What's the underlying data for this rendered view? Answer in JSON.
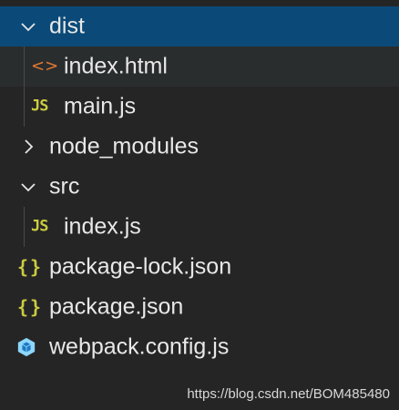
{
  "explorer": {
    "items": [
      {
        "label": "dist",
        "kind": "folder",
        "expanded": true,
        "depth": 0,
        "selected": true
      },
      {
        "label": "index.html",
        "kind": "html",
        "depth": 1,
        "hover": true
      },
      {
        "label": "main.js",
        "kind": "js",
        "depth": 1
      },
      {
        "label": "node_modules",
        "kind": "folder",
        "expanded": false,
        "depth": 0
      },
      {
        "label": "src",
        "kind": "folder",
        "expanded": true,
        "depth": 0
      },
      {
        "label": "index.js",
        "kind": "js",
        "depth": 1
      },
      {
        "label": "package-lock.json",
        "kind": "json",
        "depth": 0
      },
      {
        "label": "package.json",
        "kind": "json",
        "depth": 0
      },
      {
        "label": "webpack.config.js",
        "kind": "webpack",
        "depth": 0
      }
    ],
    "icons": {
      "js": "JS",
      "html": "<>",
      "json": "{}"
    },
    "colors": {
      "background": "#252526",
      "selected": "#0b4a78",
      "hover": "#2a2d2e",
      "js_icon": "#cbcb41",
      "html_icon": "#e37933",
      "webpack_icon": "#8ed6fb"
    }
  },
  "watermark": "https://blog.csdn.net/BOM485480"
}
